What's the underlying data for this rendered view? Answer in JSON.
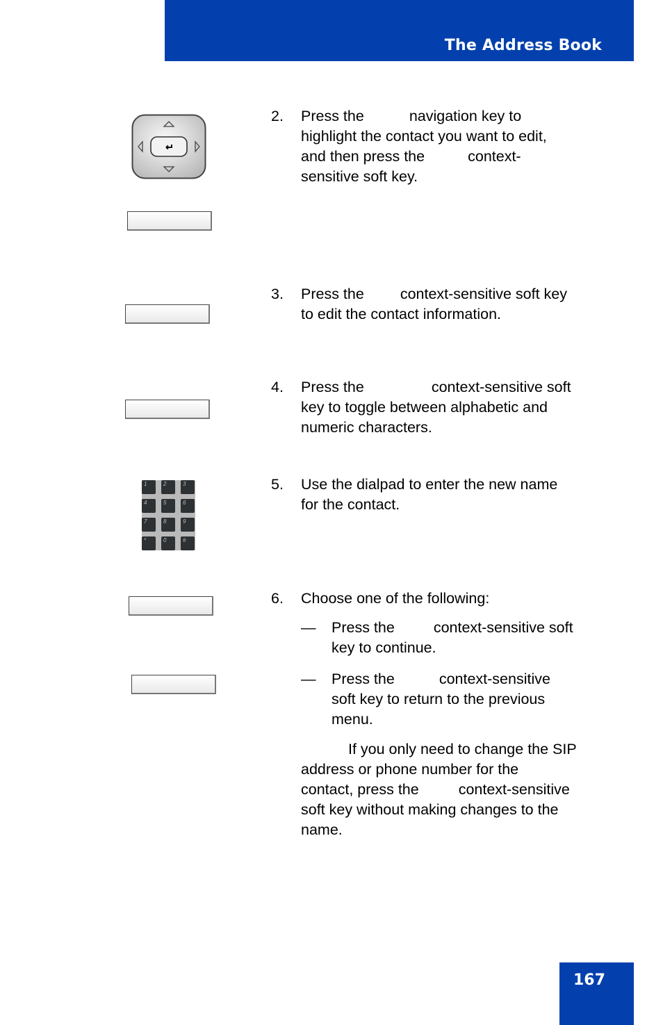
{
  "header": {
    "title": "The Address Book",
    "color": "#0340ad"
  },
  "footer": {
    "page_number": "167"
  },
  "steps": [
    {
      "number": "2.",
      "lines": [
        [
          "Press the",
          "navigation key to"
        ],
        [
          "highlight the contact you want to edit,"
        ],
        [
          "and then press the",
          "context-"
        ],
        [
          "sensitive soft key."
        ]
      ]
    },
    {
      "number": "3.",
      "lines": [
        [
          "Press the",
          "context-sensitive soft key"
        ],
        [
          "to edit the contact information."
        ]
      ]
    },
    {
      "number": "4.",
      "lines": [
        [
          "Press the",
          "context-sensitive soft"
        ],
        [
          "key to toggle between alphabetic and"
        ],
        [
          "numeric characters."
        ]
      ]
    },
    {
      "number": "5.",
      "lines": [
        [
          "Use the dialpad to enter the new name"
        ],
        [
          "for the contact."
        ]
      ]
    },
    {
      "number": "6.",
      "lines": [
        [
          "Choose one of the following:"
        ]
      ]
    }
  ],
  "sub_items": [
    {
      "dash": "—",
      "lines": [
        [
          "Press the",
          "context-sensitive soft"
        ],
        [
          "key to continue."
        ]
      ]
    },
    {
      "dash": "—",
      "lines": [
        [
          "Press the",
          "context-sensitive"
        ],
        [
          "soft key to return to the previous"
        ],
        [
          "menu."
        ]
      ]
    }
  ],
  "note": {
    "lines": [
      [
        "",
        "If you only need to change the SIP"
      ],
      [
        "address or phone number for the"
      ],
      [
        "contact, press the",
        "context-sensitive"
      ],
      [
        "soft key without making changes to the"
      ],
      [
        "name."
      ]
    ]
  },
  "icons": {
    "navigation_key": "navigation-cluster-icon",
    "dialpad_keys": [
      [
        "1",
        "2",
        "3"
      ],
      [
        "4",
        "5",
        "6"
      ],
      [
        "7",
        "8",
        "9"
      ],
      [
        "*",
        "0",
        "#"
      ]
    ]
  }
}
